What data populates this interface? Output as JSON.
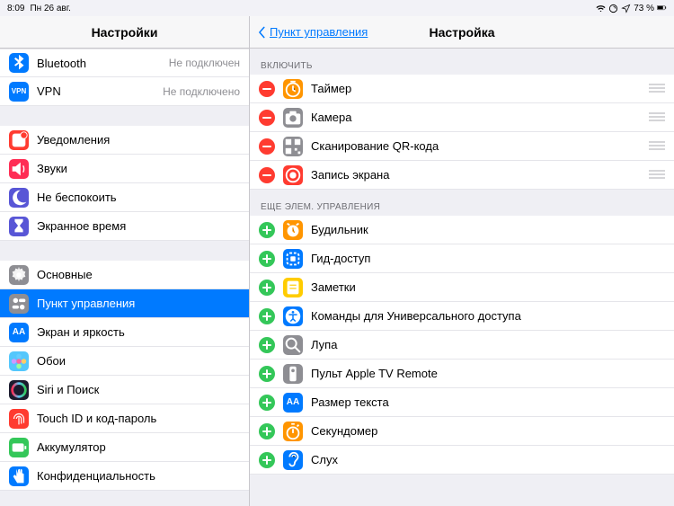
{
  "statusbar": {
    "time": "8:09",
    "date": "Пн 26 авг.",
    "battery": "73 %"
  },
  "left": {
    "title": "Настройки",
    "groups": [
      [
        {
          "id": "bluetooth",
          "label": "Bluetooth",
          "detail": "Не подключен",
          "icon": "bluetooth",
          "bg": "#007aff"
        },
        {
          "id": "vpn",
          "label": "VPN",
          "detail": "Не подключено",
          "icon": "vpn",
          "bg": "#007aff"
        }
      ],
      [
        {
          "id": "notifications",
          "label": "Уведомления",
          "icon": "notifications",
          "bg": "#ff3b30"
        },
        {
          "id": "sounds",
          "label": "Звуки",
          "icon": "sounds",
          "bg": "#ff2d55"
        },
        {
          "id": "dnd",
          "label": "Не беспокоить",
          "icon": "moon",
          "bg": "#5856d6"
        },
        {
          "id": "screentime",
          "label": "Экранное время",
          "icon": "hourglass",
          "bg": "#5856d6"
        }
      ],
      [
        {
          "id": "general",
          "label": "Основные",
          "icon": "gear",
          "bg": "#8e8e93"
        },
        {
          "id": "control-center",
          "label": "Пункт управления",
          "icon": "switches",
          "bg": "#8e8e93",
          "selected": true
        },
        {
          "id": "display",
          "label": "Экран и яркость",
          "icon": "aa",
          "bg": "#007aff"
        },
        {
          "id": "wallpaper",
          "label": "Обои",
          "icon": "flower",
          "bg": "#54c7fc"
        },
        {
          "id": "siri",
          "label": "Siri и Поиск",
          "icon": "siri",
          "bg": "#1b1b2e"
        },
        {
          "id": "touchid",
          "label": "Touch ID и код-пароль",
          "icon": "fingerprint",
          "bg": "#ff3b30"
        },
        {
          "id": "battery",
          "label": "Аккумулятор",
          "icon": "battery",
          "bg": "#34c759"
        },
        {
          "id": "privacy",
          "label": "Конфиденциальность",
          "icon": "hand",
          "bg": "#007aff"
        }
      ]
    ]
  },
  "right": {
    "back": "Пункт управления",
    "title": "Настройка",
    "includeHeader": "ВКЛЮЧИТЬ",
    "moreHeader": "ЕЩЕ ЭЛЕМ. УПРАВЛЕНИЯ",
    "include": [
      {
        "id": "timer",
        "label": "Таймер",
        "icon": "timer",
        "bg": "#ff9500"
      },
      {
        "id": "camera",
        "label": "Камера",
        "icon": "camera",
        "bg": "#8e8e93"
      },
      {
        "id": "qr",
        "label": "Сканирование QR-кода",
        "icon": "qr",
        "bg": "#8e8e93"
      },
      {
        "id": "screenrecord",
        "label": "Запись экрана",
        "icon": "record",
        "bg": "#ff3b30"
      }
    ],
    "more": [
      {
        "id": "alarm",
        "label": "Будильник",
        "icon": "alarm",
        "bg": "#ff9500"
      },
      {
        "id": "guided",
        "label": "Гид-доступ",
        "icon": "guided",
        "bg": "#007aff"
      },
      {
        "id": "notes",
        "label": "Заметки",
        "icon": "notes",
        "bg": "#ffcc00"
      },
      {
        "id": "accessibility",
        "label": "Команды для Универсального доступа",
        "icon": "accessibility",
        "bg": "#007aff"
      },
      {
        "id": "magnifier",
        "label": "Лупа",
        "icon": "magnifier",
        "bg": "#8e8e93"
      },
      {
        "id": "appletv",
        "label": "Пульт Apple TV Remote",
        "icon": "remote",
        "bg": "#8e8e93"
      },
      {
        "id": "textsize",
        "label": "Размер текста",
        "icon": "aa",
        "bg": "#007aff"
      },
      {
        "id": "stopwatch",
        "label": "Секундомер",
        "icon": "stopwatch",
        "bg": "#ff9500"
      },
      {
        "id": "hearing",
        "label": "Слух",
        "icon": "hearing",
        "bg": "#007aff"
      }
    ]
  }
}
